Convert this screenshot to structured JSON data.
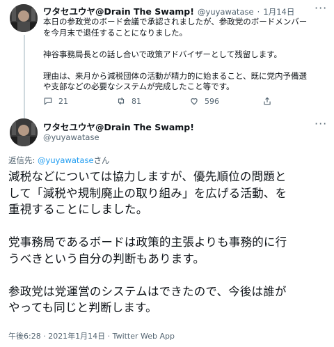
{
  "tweet1": {
    "author_name": "ワタセユウヤ@Drain The Swamp!",
    "handle": "@yuyawatase",
    "sep": "·",
    "date": "1月14日",
    "text": "本日の参政党のボード会議で承認されましたが、参政党のボードメンバー\nを今月末で退任することになりました。\n\n神谷事務局長との話し合いで政策アドバイザーとして残留します。\n\n理由は、来月から減税団体の活動が精力的に始まること、既に党内予備選\nや支部などの必要なシステムが完成したこと等です。",
    "replies": "21",
    "retweets": "81",
    "likes": "596"
  },
  "tweet2": {
    "author_name": "ワタセユウヤ@Drain The Swamp!",
    "handle": "@yuyawatase",
    "reply_prefix": "返信先: ",
    "reply_handle": "@yuyawatase",
    "reply_suffix": "さん",
    "text": "減税などについては協力しますが、優先順位の問題と\nして「減税や規制廃止の取り組み」を広げる活動、を\n重視することにしました。\n\n党事務局であるボードは政策的主張よりも事務的に行\nうべきという自分の判断もあります。\n\n参政党は党運営のシステムはできたので、今後は誰が\nやっても同じと判断します。",
    "timestamp": "午後6:28 · 2021年1月14日 · Twitter Web App"
  },
  "colors": {
    "accent": "#1d9bf0",
    "muted": "#536471",
    "text": "#0f1419"
  },
  "icons": {
    "reply": "reply-icon",
    "retweet": "retweet-icon",
    "like": "heart-icon",
    "share": "share-icon",
    "more": "more-icon"
  }
}
